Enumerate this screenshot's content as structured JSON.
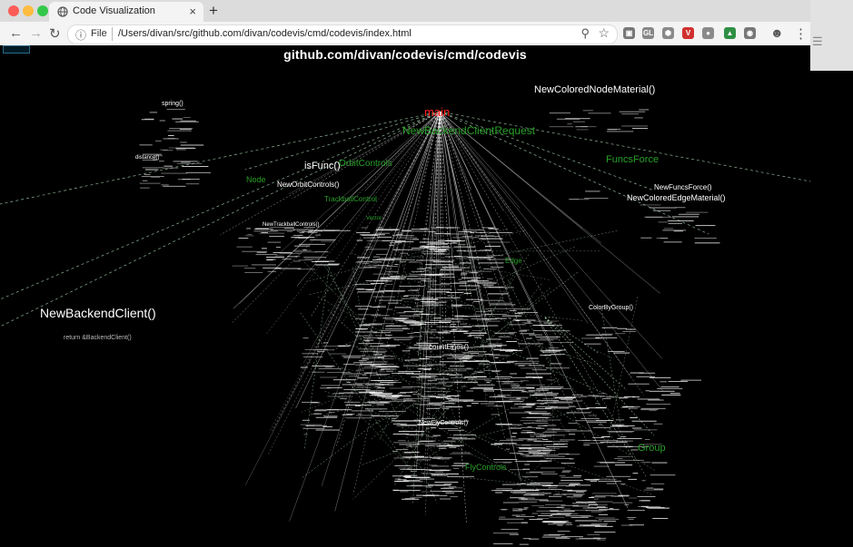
{
  "window": {
    "tab_title": "Code Visualization",
    "close_glyph": "×",
    "new_tab_glyph": "+",
    "traffic_colors": [
      "#fc5c57",
      "#fdbc40",
      "#34c84a"
    ]
  },
  "toolbar": {
    "back_glyph": "←",
    "forward_glyph": "→",
    "reload_glyph": "↻",
    "info_glyph": "ⓘ",
    "scheme": "File",
    "url": "/Users/divan/src/github.com/divan/codevis/cmd/codevis/index.html",
    "zoom_glyph": "⚲",
    "star_glyph": "☆",
    "extensions": [
      {
        "label": "▣",
        "color": "#777"
      },
      {
        "label": "GL",
        "color": "#888"
      },
      {
        "label": "⬢",
        "color": "#8a8a8a"
      },
      {
        "label": "V",
        "color": "#d03030"
      },
      {
        "label": "●",
        "color": "#8a8a8a"
      },
      {
        "label": "▲",
        "color": "#2f8f45"
      },
      {
        "label": "◉",
        "color": "#777"
      }
    ],
    "profile_glyph": "☻",
    "menu_glyph": "⋮",
    "panel_glyph": "☰"
  },
  "page": {
    "heading": "github.com/divan/codevis/cmd/codevis"
  },
  "scene": {
    "accent": "#c8ffd0",
    "hub_label": "main",
    "labels": [
      {
        "text": "main",
        "color": "#ff2020",
        "size": 13
      },
      {
        "text": "NewColoredNodeMaterial()",
        "color": "#ffffff",
        "size": 11
      },
      {
        "text": "NewBackendClientRequest",
        "color": "#2aa02a",
        "size": 12
      },
      {
        "text": "isFunc()",
        "color": "#ffffff",
        "size": 11
      },
      {
        "text": "OrbitControls",
        "color": "#2aa02a",
        "size": 10
      },
      {
        "text": "Node",
        "color": "#2aa02a",
        "size": 9
      },
      {
        "text": "NewOrbitControls()",
        "color": "#ffffff",
        "size": 8
      },
      {
        "text": "TrackballControl",
        "color": "#2aa02a",
        "size": 8
      },
      {
        "text": "FuncsForce",
        "color": "#2aa02a",
        "size": 11
      },
      {
        "text": "NewFuncsForce()",
        "color": "#ffffff",
        "size": 8
      },
      {
        "text": "NewColoredEdgeMaterial()",
        "color": "#ffffff",
        "size": 9
      },
      {
        "text": "NewBackendClient()",
        "color": "#ffffff",
        "size": 14
      },
      {
        "text": "return &BackendClient()",
        "color": "#bbbbbb",
        "size": 7
      },
      {
        "text": "ColorByGroup()",
        "color": "#ffffff",
        "size": 7
      },
      {
        "text": "countLines()",
        "color": "#ffffff",
        "size": 8
      },
      {
        "text": "NewFlyControls()",
        "color": "#ffffff",
        "size": 7
      },
      {
        "text": "FlyControls",
        "color": "#2aa02a",
        "size": 9
      },
      {
        "text": "Edge",
        "color": "#2aa02a",
        "size": 8
      },
      {
        "text": "Group",
        "color": "#2aa02a",
        "size": 11
      },
      {
        "text": "spring()",
        "color": "#ffffff",
        "size": 7
      },
      {
        "text": "distance()",
        "color": "#ffffff",
        "size": 6
      },
      {
        "text": "NewTrackballControls()",
        "color": "#ffffff",
        "size": 6
      },
      {
        "text": "Vector",
        "color": "#2aa02a",
        "size": 6
      }
    ]
  }
}
